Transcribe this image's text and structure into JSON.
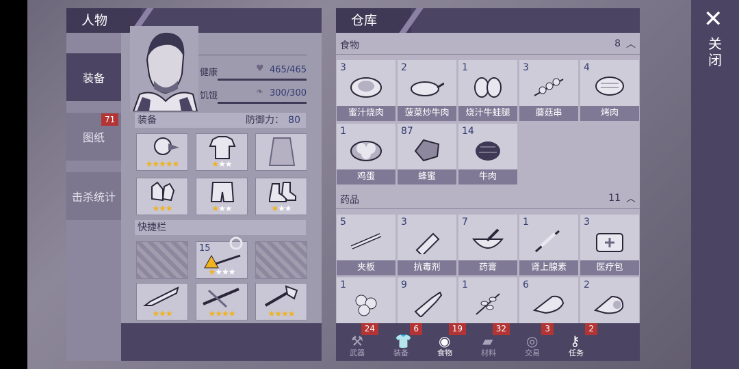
{
  "character": {
    "title": "人物",
    "tabs": [
      {
        "label": "装备",
        "active": true
      },
      {
        "label": "图纸",
        "badge": "71"
      },
      {
        "label": "击杀统计"
      }
    ],
    "health": {
      "label": "健康",
      "value": "465/465"
    },
    "hunger": {
      "label": "饥饿",
      "value": "300/300"
    },
    "equipment": {
      "label": "装备",
      "defense_label": "防御力：",
      "defense_value": "80"
    },
    "quickbar": {
      "label": "快捷栏",
      "count": "15"
    }
  },
  "warehouse": {
    "title": "仓库",
    "food": {
      "label": "食物",
      "count": "8",
      "items": [
        {
          "q": "3",
          "name": "蜜汁烧肉"
        },
        {
          "q": "2",
          "name": "菠菜炒牛肉"
        },
        {
          "q": "1",
          "name": "烧汁牛蛙腿"
        },
        {
          "q": "3",
          "name": "蘑菇串"
        },
        {
          "q": "4",
          "name": "烤肉"
        },
        {
          "q": "1",
          "name": "鸡蛋"
        },
        {
          "q": "87",
          "name": "蜂蜜"
        },
        {
          "q": "14",
          "name": "牛肉"
        }
      ]
    },
    "medicine": {
      "label": "药品",
      "count": "11",
      "items": [
        {
          "q": "5",
          "name": "夹板"
        },
        {
          "q": "3",
          "name": "抗毒剂"
        },
        {
          "q": "7",
          "name": "药膏"
        },
        {
          "q": "1",
          "name": "肾上腺素"
        },
        {
          "q": "3",
          "name": "医疗包"
        },
        {
          "q": "1",
          "name": ""
        },
        {
          "q": "9",
          "name": ""
        },
        {
          "q": "1",
          "name": ""
        },
        {
          "q": "6",
          "name": ""
        },
        {
          "q": "2",
          "name": ""
        }
      ]
    },
    "categories": [
      {
        "label": "武器",
        "badge": "24"
      },
      {
        "label": "装备",
        "badge": "6"
      },
      {
        "label": "食物",
        "badge": "19",
        "active": true
      },
      {
        "label": "材料",
        "badge": "32"
      },
      {
        "label": "交易",
        "badge": "3"
      },
      {
        "label": "任务",
        "badge": "2"
      }
    ]
  },
  "close": {
    "label": "关闭"
  },
  "colors": {
    "panel_dark": "#4b4563",
    "badge": "#b33434",
    "star": "#f1b31b"
  }
}
